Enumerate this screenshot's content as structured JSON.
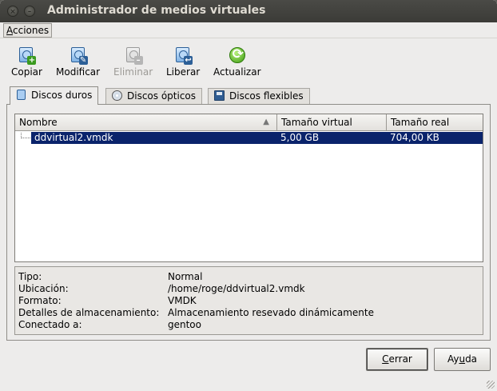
{
  "window": {
    "title": "Administrador de medios virtuales",
    "close_glyph": "×",
    "minimize_glyph": "–"
  },
  "menubar": {
    "items": [
      {
        "label_mnemonic": "A",
        "label_rest": "cciones"
      }
    ]
  },
  "toolbar": {
    "copy_label": "Copiar",
    "modify_label": "Modificar",
    "delete_label": "Eliminar",
    "release_label": "Liberar",
    "refresh_label": "Actualizar"
  },
  "tabs": [
    {
      "label": "Discos duros",
      "icon": "hard-disk-icon",
      "active": true
    },
    {
      "label": "Discos ópticos",
      "icon": "optical-disc-icon",
      "active": false
    },
    {
      "label": "Discos flexibles",
      "icon": "floppy-disk-icon",
      "active": false
    }
  ],
  "table": {
    "columns": [
      "Nombre",
      "Tamaño virtual",
      "Tamaño real"
    ],
    "sort_glyph": "▲",
    "rows": [
      {
        "name": "ddvirtual2.vmdk",
        "virtual_size": "5,00 GB",
        "actual_size": "704,00 KB",
        "selected": true
      }
    ]
  },
  "details": {
    "rows": [
      {
        "label": "Tipo:",
        "value": "Normal"
      },
      {
        "label": "Ubicación:",
        "value": "/home/roge/ddvirtual2.vmdk"
      },
      {
        "label": "Formato:",
        "value": "VMDK"
      },
      {
        "label": "Detalles de almacenamiento:",
        "value": "Almacenamiento resevado dinámicamente"
      },
      {
        "label": "Conectado a:",
        "value": "gentoo"
      }
    ]
  },
  "buttons": {
    "close": {
      "mnemonic": "C",
      "rest": "errar"
    },
    "help": {
      "prefix": "Ay",
      "mnemonic": "u",
      "rest": "da"
    }
  },
  "colors": {
    "selection": "#0a236b",
    "titlebar": "#3b3b37",
    "window_bg": "#edeceb"
  }
}
